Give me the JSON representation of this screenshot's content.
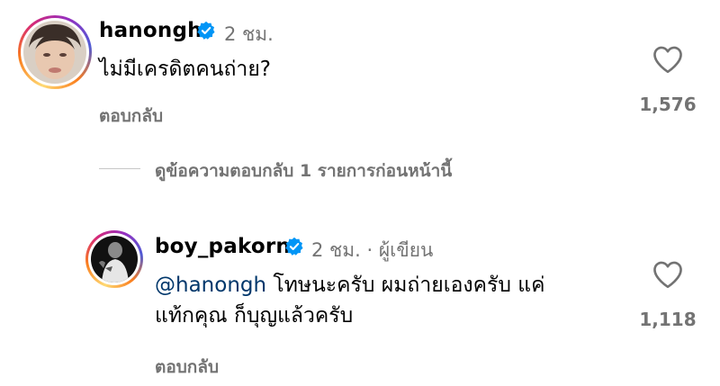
{
  "comments": [
    {
      "username": "hanongh",
      "verified": true,
      "time": "2 ชม.",
      "text": "ไม่มีเครดิตคนถ่าย?",
      "reply_label": "ตอบกลับ",
      "like_count": "1,576",
      "icon": "heart-outline-icon"
    },
    {
      "username": "boy_pakorn",
      "verified": true,
      "time": "2 ชม.",
      "separator": "·",
      "author_badge": "ผู้เขียน",
      "mention": "@hanongh",
      "text_line1": "โทษนะครับ ผมถ่ายเองครับ แค่",
      "text_line2": "แท้กคุณ ก็บุญแล้วครับ",
      "reply_label": "ตอบกลับ",
      "like_count": "1,118",
      "icon": "heart-outline-icon"
    }
  ],
  "view_previous_replies": "ดูข้อความตอบกลับ 1 รายการก่อนหน้านี้",
  "colors": {
    "verified": "#0095f6",
    "mention": "#00376b",
    "secondary_text": "#737373"
  }
}
